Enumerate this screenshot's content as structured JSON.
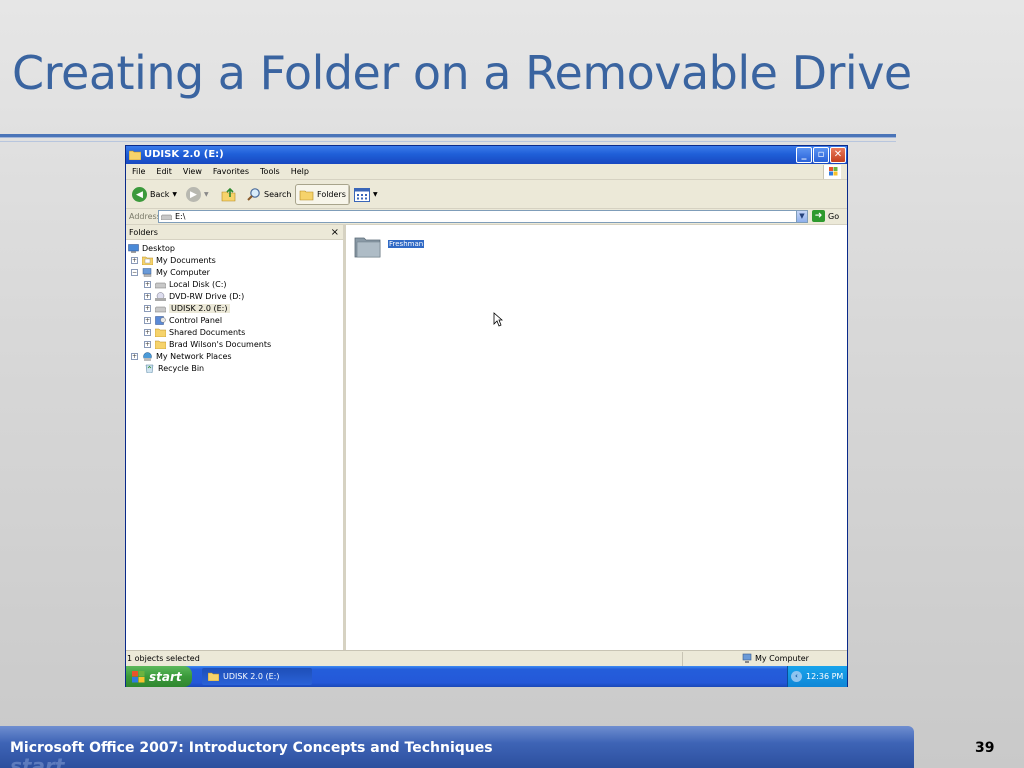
{
  "slide": {
    "title": "Creating a Folder on a Removable Drive",
    "footer": "Microsoft Office 2007: Introductory Concepts and Techniques",
    "footer_watermark": "start",
    "page_number": "39"
  },
  "window": {
    "title": "UDISK 2.0 (E:)",
    "buttons": {
      "minimize": "_",
      "maximize": "▫",
      "close": "✕"
    }
  },
  "menu": {
    "items": [
      "File",
      "Edit",
      "View",
      "Favorites",
      "Tools",
      "Help"
    ]
  },
  "toolbar": {
    "back_label": "Back",
    "search_label": "Search",
    "folders_label": "Folders"
  },
  "address": {
    "label": "Address",
    "value": "E:\\",
    "go_label": "Go"
  },
  "folders_pane": {
    "header": "Folders",
    "close": "×",
    "items": [
      {
        "label": "Desktop",
        "level": 0,
        "expander": "",
        "icon": "desktop-icon"
      },
      {
        "label": "My Documents",
        "level": 1,
        "expander": "+",
        "icon": "my-documents-icon"
      },
      {
        "label": "My Computer",
        "level": 1,
        "expander": "−",
        "icon": "my-computer-icon"
      },
      {
        "label": "Local Disk (C:)",
        "level": 2,
        "expander": "+",
        "icon": "hard-disk-icon"
      },
      {
        "label": "DVD-RW Drive (D:)",
        "level": 2,
        "expander": "+",
        "icon": "dvd-drive-icon"
      },
      {
        "label": "UDISK 2.0 (E:)",
        "level": 2,
        "expander": "+",
        "icon": "removable-drive-icon",
        "selected": true
      },
      {
        "label": "Control Panel",
        "level": 2,
        "expander": "+",
        "icon": "control-panel-icon"
      },
      {
        "label": "Shared Documents",
        "level": 2,
        "expander": "+",
        "icon": "folder-icon"
      },
      {
        "label": "Brad Wilson's Documents",
        "level": 2,
        "expander": "+",
        "icon": "folder-icon"
      },
      {
        "label": "My Network Places",
        "level": 1,
        "expander": "+",
        "icon": "network-places-icon"
      },
      {
        "label": "Recycle Bin",
        "level": 1,
        "expander": "",
        "icon": "recycle-bin-icon"
      }
    ]
  },
  "content": {
    "folder_name": "Freshman"
  },
  "status": {
    "left": "1 objects selected",
    "right": "My Computer"
  },
  "taskbar": {
    "start_label": "start",
    "task_label": "UDISK 2.0 (E:)",
    "tray_chevron": "‹",
    "clock": "12:36 PM"
  },
  "colors": {
    "title": "#3a64a0",
    "xp_blue": "#245edb",
    "start_green": "#3a9a3a",
    "selection": "#316ac5"
  }
}
